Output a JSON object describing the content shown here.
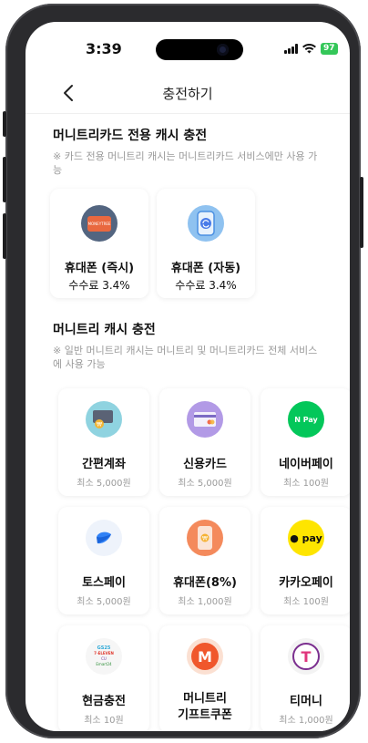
{
  "status": {
    "time": "3:39",
    "battery": "97"
  },
  "header": {
    "title": "충전하기"
  },
  "card_section": {
    "title": "머니트리카드 전용 캐시 충전",
    "note": "※ 카드 전용 머니트리 캐시는 머니트리카드 서비스에만 사용 가능",
    "items": [
      {
        "label": "휴대폰 (즉시)",
        "fee": "수수료 3.4%",
        "icon": "card-instant-icon",
        "badge": "MONEYTREE"
      },
      {
        "label": "휴대폰 (자동)",
        "fee": "수수료 3.4%",
        "icon": "phone-auto-charge-icon"
      }
    ]
  },
  "cash_section": {
    "title": "머니트리 캐시 충전",
    "note": "※ 일반 머니트리 캐시는 머니트리 및 머니트리카드 전체 서비스에 사용 가능",
    "items": [
      {
        "label": "간편계좌",
        "sub": "최소 5,000원",
        "icon": "bank-account-icon"
      },
      {
        "label": "신용카드",
        "sub": "최소 5,000원",
        "icon": "credit-card-icon"
      },
      {
        "label": "네이버페이",
        "sub": "최소 100원",
        "icon": "naver-pay-icon",
        "icon_text": "N Pay"
      },
      {
        "label": "토스페이",
        "sub": "최소 5,000원",
        "icon": "toss-pay-icon"
      },
      {
        "label": "휴대폰(8%)",
        "sub": "최소 1,000원",
        "icon": "mobile-phone-icon"
      },
      {
        "label": "카카오페이",
        "sub": "최소 100원",
        "icon": "kakao-pay-icon",
        "icon_text": "pay"
      },
      {
        "label": "현금충전",
        "sub": "최소 10원",
        "icon": "convenience-store-icon",
        "icon_lines": [
          "GS25",
          "7-ELEVEN",
          "CU",
          "Emart24"
        ]
      },
      {
        "label": "머니트리\n기프트쿠폰",
        "sub": "",
        "icon": "gift-coupon-icon",
        "icon_text": "M"
      },
      {
        "label": "티머니",
        "sub": "최소 1,000원",
        "icon": "tmoney-icon",
        "icon_text": "T"
      }
    ]
  },
  "colors": {
    "accent_green": "#03c75a",
    "kakao_yellow": "#fee500",
    "toss_blue": "#3182f6",
    "battery_green": "#34c759"
  }
}
